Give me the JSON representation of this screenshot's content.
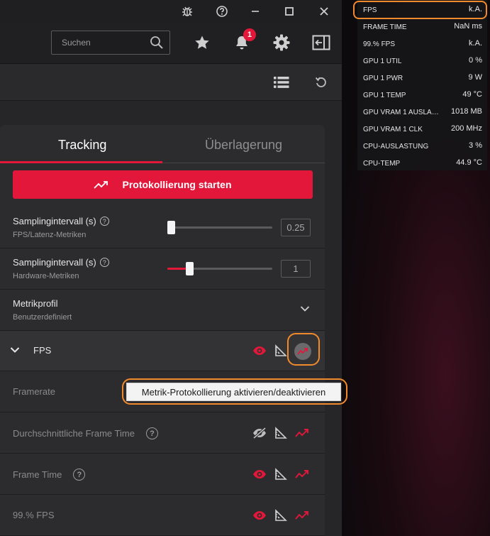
{
  "search": {
    "placeholder": "Suchen"
  },
  "notifications": {
    "count": "1"
  },
  "tabs": [
    {
      "label": "Tracking",
      "active": true
    },
    {
      "label": "Überlagerung",
      "active": false
    }
  ],
  "logging_button": {
    "label": "Protokollierung starten"
  },
  "settings": {
    "sampling_fps": {
      "title": "Samplingintervall (s)",
      "subtitle": "FPS/Latenz-Metriken",
      "value": "0.25",
      "level": 0.0
    },
    "sampling_hw": {
      "title": "Samplingintervall (s)",
      "subtitle": "Hardware-Metriken",
      "value": "1",
      "level": 0.19
    },
    "profile": {
      "title": "Metrikprofil",
      "subtitle": "Benutzerdefiniert"
    }
  },
  "fps_group": {
    "label": "FPS"
  },
  "metrics": [
    {
      "label": "Framerate",
      "visible": true,
      "has_help": false
    },
    {
      "label": "Durchschnittliche Frame Time",
      "visible": false,
      "has_help": true
    },
    {
      "label": "Frame Time",
      "visible": true,
      "has_help": true
    },
    {
      "label": "99.% FPS",
      "visible": true,
      "has_help": false
    }
  ],
  "tooltip": {
    "text": "Metrik-Protokollierung aktivieren/deaktivieren"
  },
  "overlay": [
    {
      "name": "FPS",
      "value": "k.A."
    },
    {
      "name": "FRAME TIME",
      "value": "NaN ms"
    },
    {
      "name": "99.% FPS",
      "value": "k.A."
    },
    {
      "name": "GPU 1 UTIL",
      "value": "0 %"
    },
    {
      "name": "GPU 1 PWR",
      "value": "9 W"
    },
    {
      "name": "GPU 1 TEMP",
      "value": "49 °C"
    },
    {
      "name": "GPU VRAM 1 AUSLA…",
      "value": "1018 MB"
    },
    {
      "name": "GPU VRAM 1 CLK",
      "value": "200 MHz"
    },
    {
      "name": "CPU-AUSLASTUNG",
      "value": "3 %"
    },
    {
      "name": "CPU-TEMP",
      "value": "44.9 °C"
    }
  ],
  "colors": {
    "accent": "#e2173a",
    "highlight": "#f08a2c"
  }
}
